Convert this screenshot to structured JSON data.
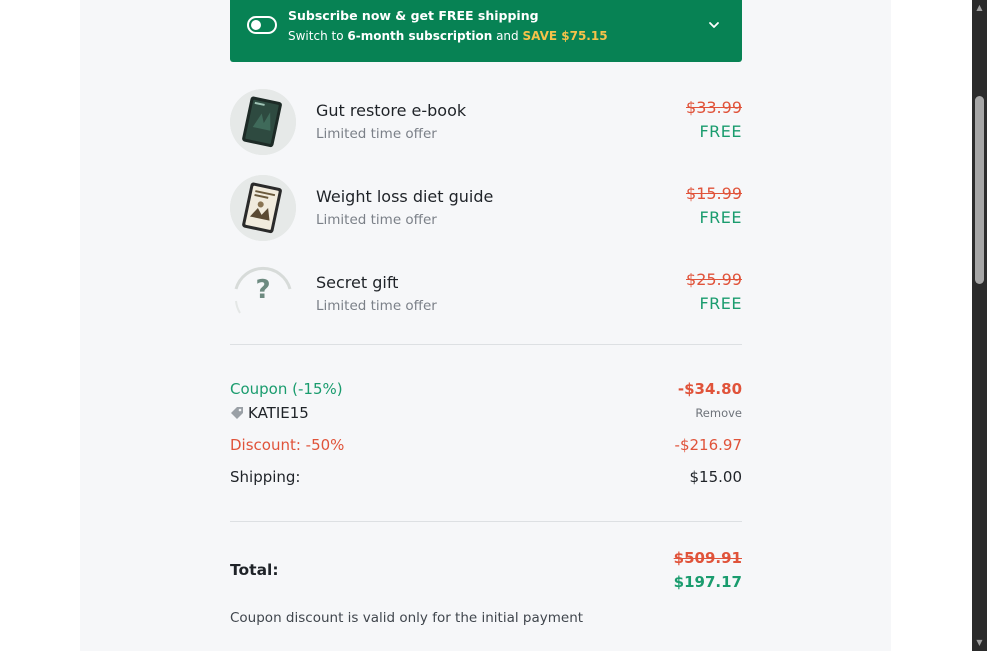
{
  "banner": {
    "title": "Subscribe now & get FREE shipping",
    "sub_prefix": "Switch to",
    "sub_bold": "6-month subscription",
    "sub_mid": "and",
    "sub_save": "SAVE $75.15",
    "toggle_on": false
  },
  "items": [
    {
      "name": "Gut restore e-book",
      "sub": "Limited time offer",
      "old_price": "$33.99",
      "price": "FREE",
      "icon": "ebook-tablet-image"
    },
    {
      "name": "Weight loss diet guide",
      "sub": "Limited time offer",
      "old_price": "$15.99",
      "price": "FREE",
      "icon": "guide-tablet-image"
    },
    {
      "name": "Secret gift",
      "sub": "Limited time offer",
      "old_price": "$25.99",
      "price": "FREE",
      "icon": "question-mark-icon",
      "icon_glyph": "?"
    }
  ],
  "summary": {
    "coupon_label": "Coupon (-15%)",
    "coupon_value": "-$34.80",
    "coupon_code": "KATIE15",
    "remove_label": "Remove",
    "discount_label": "Discount: -50%",
    "discount_value": "-$216.97",
    "shipping_label": "Shipping:",
    "shipping_value": "$15.00"
  },
  "total": {
    "label": "Total:",
    "old_value": "$509.91",
    "value": "$197.17"
  },
  "note": "Coupon discount is valid only for the initial payment",
  "colors": {
    "banner_green": "#078254",
    "accent_green": "#1a9c6e",
    "strike_red": "#e0533a",
    "save_yellow": "#f5c24a"
  },
  "scrollbar": {
    "up_arrow": "▲",
    "down_arrow": "▼"
  }
}
